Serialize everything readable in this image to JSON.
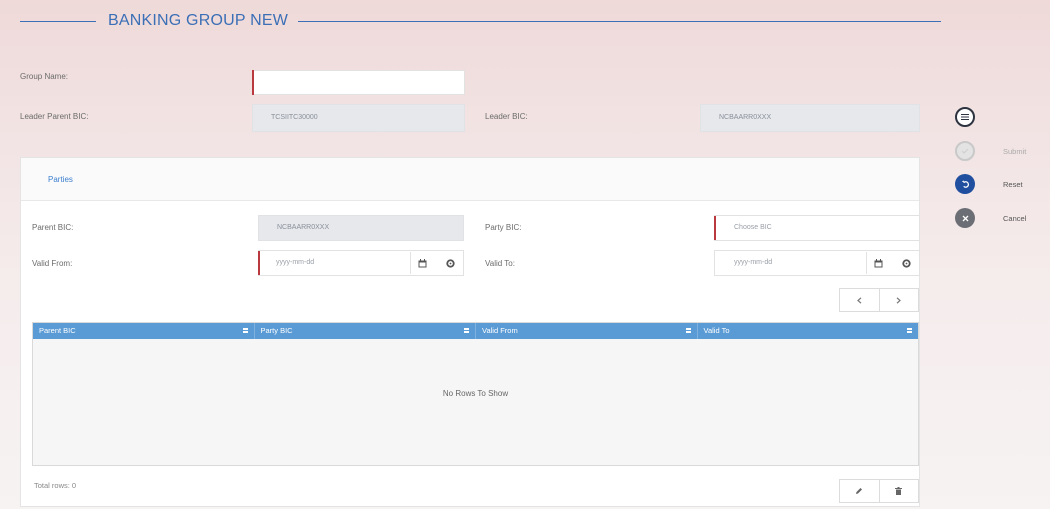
{
  "page": {
    "title": "BANKING GROUP NEW"
  },
  "form": {
    "group_name_label": "Group Name:",
    "group_name_value": "",
    "leader_parent_bic_label": "Leader Parent BIC:",
    "leader_parent_bic_value": "TCSIITC30000",
    "leader_bic_label": "Leader BIC:",
    "leader_bic_value": "NCBAARR0XXX"
  },
  "tabs": [
    {
      "label": "Parties"
    }
  ],
  "party_form": {
    "parent_bic_label": "Parent BIC:",
    "parent_bic_value": "NCBAARR0XXX",
    "party_bic_label": "Party BIC:",
    "party_bic_placeholder": "Choose BIC",
    "valid_from_label": "Valid From:",
    "valid_from_placeholder": "yyyy-mm-dd",
    "valid_to_label": "Valid To:",
    "valid_to_placeholder": "yyyy-mm-dd"
  },
  "table": {
    "columns": [
      "Parent BIC",
      "Party BIC",
      "Valid From",
      "Valid To"
    ],
    "empty_message": "No Rows To Show",
    "total_rows": "Total rows: 0"
  },
  "side_actions": {
    "submit_label": "Submit",
    "reset_label": "Reset",
    "cancel_label": "Cancel"
  },
  "colors": {
    "accent": "#3b6fb6",
    "table_header": "#5b9bd5",
    "required": "#b9393f",
    "reset_button": "#1f4f9e",
    "cancel_button": "#6b6f75"
  },
  "icons": {
    "calendar": "calendar-icon",
    "settings": "gear-icon",
    "menu": "menu-icon",
    "reset": "undo-icon",
    "cancel": "close-icon",
    "edit": "pencil-icon",
    "delete": "trash-icon",
    "prev": "chevron-left-icon",
    "next": "chevron-right-icon"
  }
}
